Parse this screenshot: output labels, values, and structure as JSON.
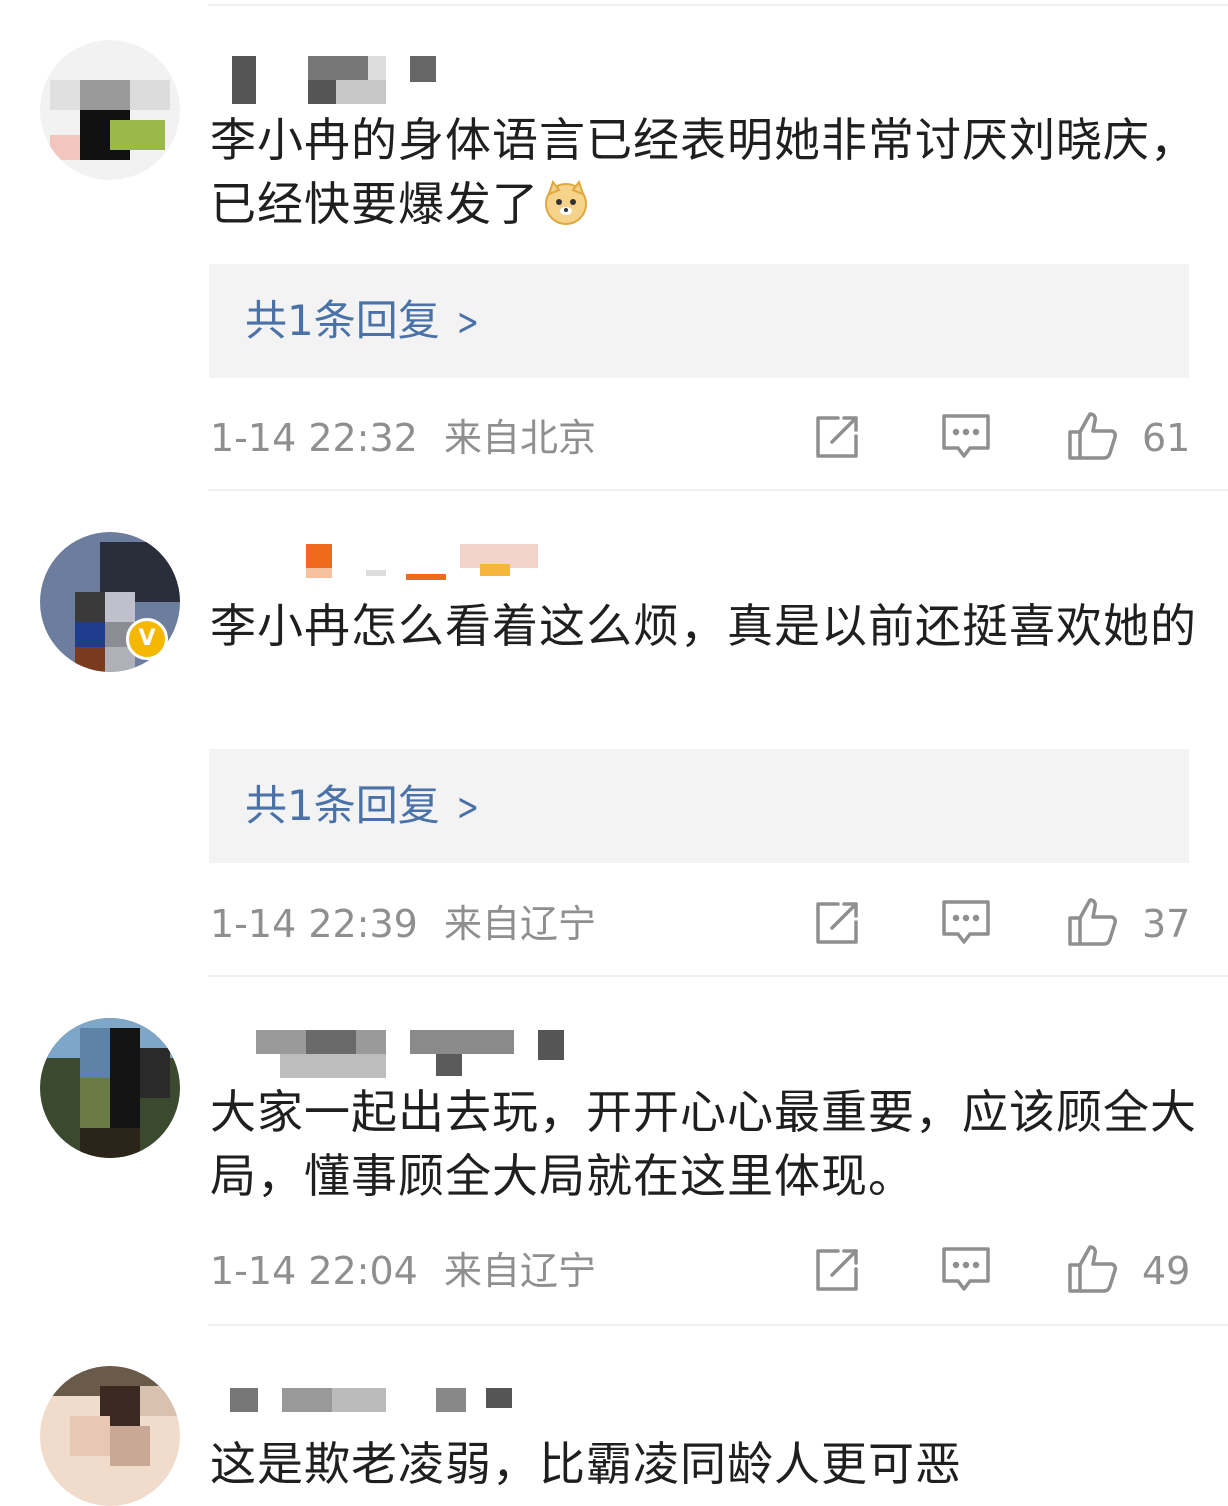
{
  "comments": [
    {
      "text": "李小冉的身体语言已经表明她非常讨厌刘晓庆，已经快要爆发了",
      "emoji": "doge-emoji",
      "reply_label": "共1条回复",
      "time": "1-14 22:32",
      "location": "来自北京",
      "likes": "61"
    },
    {
      "text": "李小冉怎么看着这么烦，真是以前还挺喜欢她的",
      "reply_label": "共1条回复",
      "time": "1-14 22:39",
      "location": "来自辽宁",
      "likes": "37",
      "verified_mark": "V"
    },
    {
      "text": "大家一起出去玩，开开心心最重要，应该顾全大局，懂事顾全大局就在这里体现。",
      "time": "1-14 22:04",
      "location": "来自辽宁",
      "likes": "49"
    },
    {
      "text": "这是欺老凌弱，比霸凌同龄人更可恶"
    }
  ],
  "colors": {
    "link": "#4a72a8",
    "meta_gray": "#8f8f8f",
    "reply_bg": "#f3f3f3",
    "verified": "#f6b700"
  },
  "icons": [
    "share-icon",
    "comment-icon",
    "like-icon",
    "chevron-right-icon"
  ]
}
